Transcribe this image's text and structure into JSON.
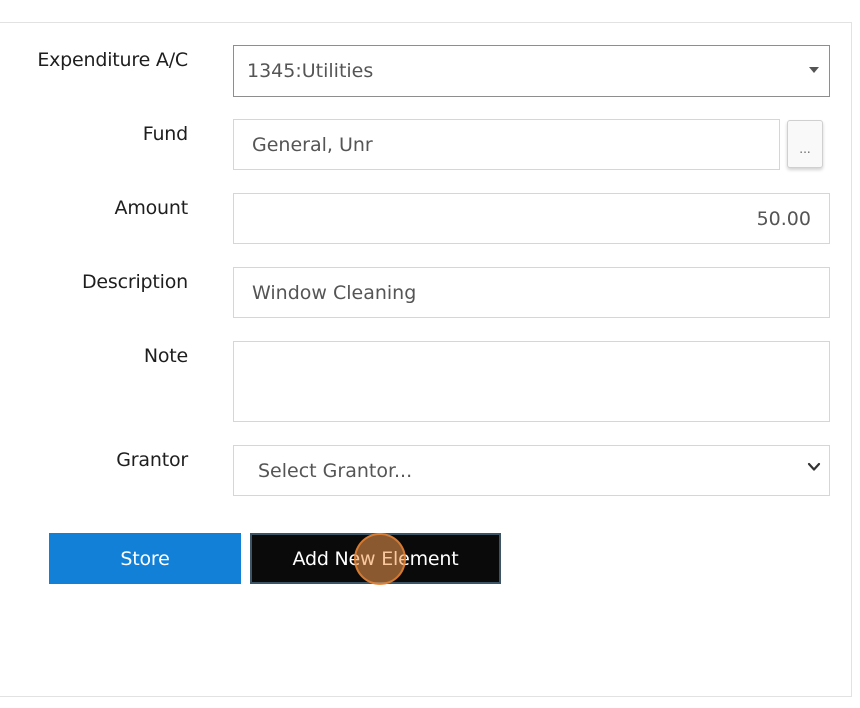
{
  "form": {
    "expenditure": {
      "label": "Expenditure A/C",
      "value": "1345:Utilities"
    },
    "fund": {
      "label": "Fund",
      "value": "General, Unr",
      "lookup_label": "..."
    },
    "amount": {
      "label": "Amount",
      "value": "50.00"
    },
    "description": {
      "label": "Description",
      "value": "Window Cleaning"
    },
    "note": {
      "label": "Note",
      "value": ""
    },
    "grantor": {
      "label": "Grantor",
      "placeholder": "Select Grantor..."
    }
  },
  "actions": {
    "store_label": "Store",
    "add_label": "Add New Element"
  },
  "colors": {
    "store_button": "#1380d8",
    "add_button": "#0a0a0a",
    "cursor_highlight": "#f49b50"
  }
}
